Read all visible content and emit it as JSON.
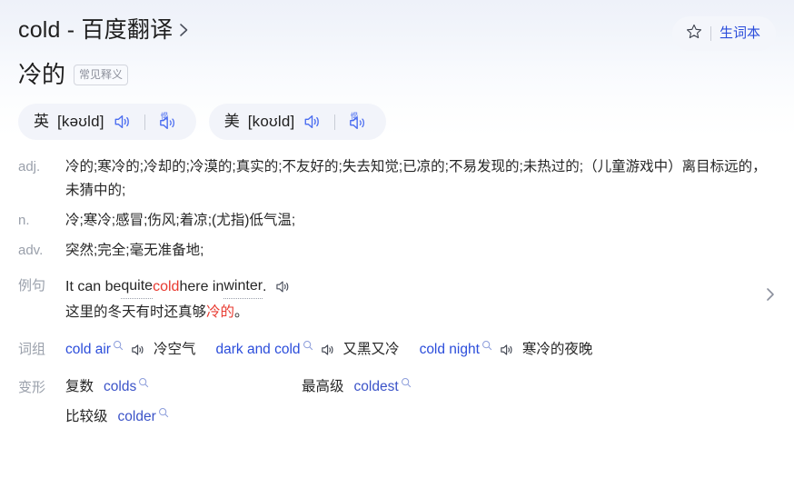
{
  "header": {
    "title": "cold - 百度翻译",
    "title_chevron_icon": "chevron-right-icon",
    "favorite": {
      "star_icon": "star-outline-icon",
      "label": "生词本"
    }
  },
  "headword": {
    "text": "冷的",
    "sense_tag": "常见释义"
  },
  "pronunciations": [
    {
      "locale": "英",
      "ipa": "[kəʊld]",
      "speaker_icon": "speaker-icon",
      "slow_speaker_icon": "slow-speaker-icon",
      "slow_label": "慢"
    },
    {
      "locale": "美",
      "ipa": "[koʊld]",
      "speaker_icon": "speaker-icon",
      "slow_speaker_icon": "slow-speaker-icon",
      "slow_label": "慢"
    }
  ],
  "definitions": [
    {
      "pos": "adj.",
      "text": "冷的;寒冷的;冷却的;冷漠的;真实的;不友好的;失去知觉;已凉的;不易发现的;未热过的;（儿童游戏中）离目标远的，未猜中的;"
    },
    {
      "pos": "n.",
      "text": "冷;寒冷;感冒;伤风;着凉;(尤指)低气温;"
    },
    {
      "pos": "adv.",
      "text": "突然;完全;毫无准备地;"
    }
  ],
  "example": {
    "label": "例句",
    "en_parts": [
      {
        "text": "It can be ",
        "style": "plain"
      },
      {
        "text": "quite",
        "style": "dotted"
      },
      {
        "text": " ",
        "style": "plain"
      },
      {
        "text": "cold",
        "style": "highlight"
      },
      {
        "text": " here in ",
        "style": "plain"
      },
      {
        "text": "winter",
        "style": "dotted"
      },
      {
        "text": ".",
        "style": "plain"
      }
    ],
    "en_plain": "It can be quite cold here in winter.",
    "cn_prefix": "这里的冬天有时还真够",
    "cn_highlight": "冷的",
    "cn_suffix": "。",
    "speaker_icon": "speaker-icon",
    "more_icon": "chevron-right-icon"
  },
  "phrases": {
    "label": "词组",
    "items": [
      {
        "en": "cold air",
        "cn": "冷空气",
        "search_icon": "search-icon",
        "speaker_icon": "speaker-icon"
      },
      {
        "en": "dark and cold",
        "cn": "又黑又冷",
        "search_icon": "search-icon",
        "speaker_icon": "speaker-icon"
      },
      {
        "en": "cold night",
        "cn": "寒冷的夜晚",
        "search_icon": "search-icon",
        "speaker_icon": "speaker-icon"
      }
    ]
  },
  "forms": {
    "label": "变形",
    "items": [
      {
        "kind": "复数",
        "value": "colds",
        "search_icon": "search-icon"
      },
      {
        "kind": "最高级",
        "value": "coldest",
        "search_icon": "search-icon"
      },
      {
        "kind": "比较级",
        "value": "colder",
        "search_icon": "search-icon"
      }
    ]
  },
  "colors": {
    "link_blue": "#2b4ddb",
    "highlight_red": "#e8392f",
    "label_gray": "#9aa0ab",
    "pill_bg": "#f2f4fa"
  }
}
